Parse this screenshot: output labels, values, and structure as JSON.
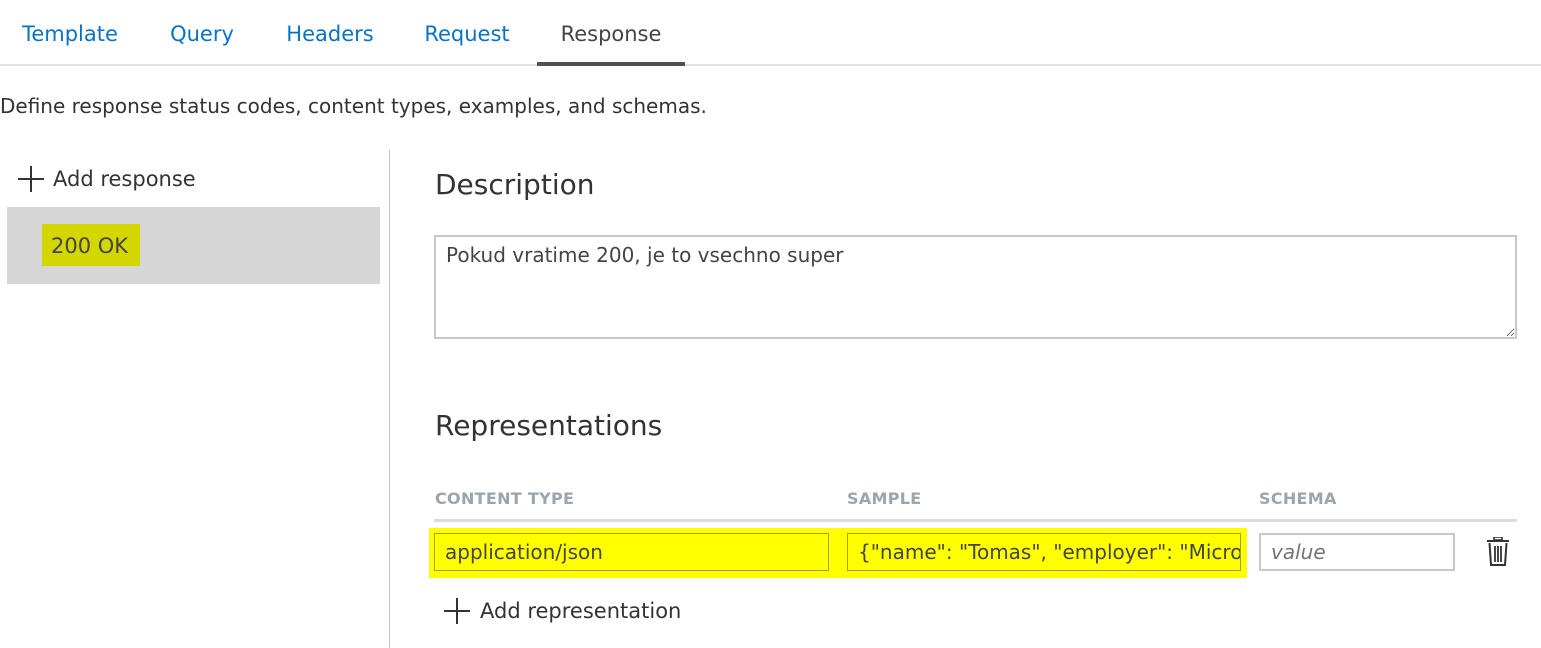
{
  "tabs": [
    {
      "label": "Template",
      "active": false
    },
    {
      "label": "Query",
      "active": false
    },
    {
      "label": "Headers",
      "active": false
    },
    {
      "label": "Request",
      "active": false
    },
    {
      "label": "Response",
      "active": true
    }
  ],
  "intro": "Define response status codes, content types, examples, and schemas.",
  "sidebar": {
    "add_label": "Add response",
    "add_icon": "plus-icon",
    "responses": [
      {
        "label": "200 OK",
        "selected": true
      }
    ]
  },
  "description": {
    "heading": "Description",
    "value": "Pokud vratime 200, je to vsechno super"
  },
  "representations": {
    "heading": "Representations",
    "columns": [
      "CONTENT TYPE",
      "SAMPLE",
      "SCHEMA"
    ],
    "rows": [
      {
        "content_type": "application/json",
        "sample": "{\"name\": \"Tomas\", \"employer\": \"Micro",
        "schema_placeholder": "value",
        "delete_icon": "trash-icon"
      }
    ],
    "add_label": "Add representation",
    "add_icon": "plus-icon"
  },
  "colors": {
    "link": "#0b72c4",
    "highlight": "#ffff00",
    "selected_bg": "#d6d6d6",
    "header_text": "#9aa5ae"
  }
}
